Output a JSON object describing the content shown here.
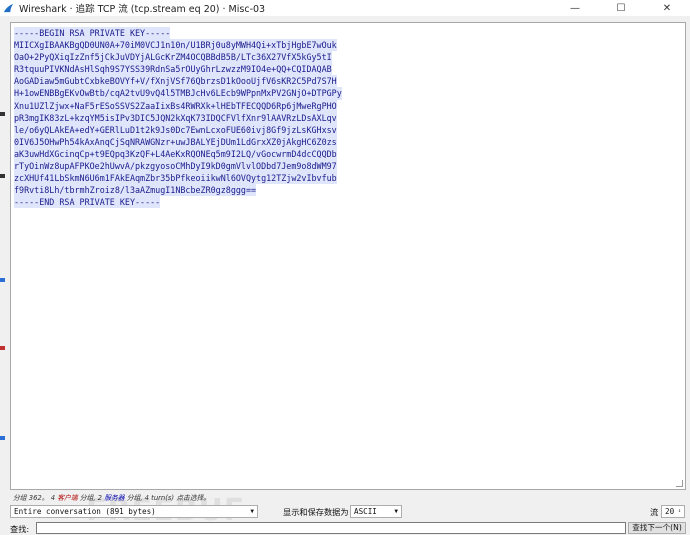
{
  "window": {
    "title": "Wireshark · 追踪 TCP 流 (tcp.stream eq 20) · Misc-03",
    "minimize": "—",
    "maximize": "☐",
    "close": "✕"
  },
  "stream": {
    "lines": [
      "-----BEGIN RSA PRIVATE KEY-----",
      "MIICXgIBAAKBgQD0UN0A+70iM0VCJ1n10n/U1BRj0u8yMWH4Qi+xTbjHgbE7wOuk",
      "OaO+2PyQXiqIzZnf5jCkJuVDYjALGcKrZM4OCQBBdB5B/LTc36X27VfX5kGy5tI",
      "R3tquuPIVKNdAsHlSqh9S7YSS39RdnSa5rOUyGhrLzwzzM9IO4e+QQ+CQIDAQAB",
      "AoGADiaw5mGubtCxbkeBOVYf+V/fXnjVSf76QbrzsD1kOooUjfV6sKR2C5Pd7S7H",
      "H+1owENBBgEKvOwBtb/cqA2tvU9vQ4l5TMBJcHv6LEcb9WPpnMxPV2GNjO+DTPGPy",
      "Xnu1UZlZjwx+NaF5rESoSSVS2ZaaIixBs4RWRXk+lHEbTFECQQD6Rp6jMweRgPHO",
      "pR3mgIK83zL+kzqYM5isIPv3DIC5JQN2kXqK73IDQCFVlfXnr9lAAVRzLDsAXLqv",
      "le/o6yQLAkEA+edY+GERlLuD1t2k9Js0Dc7EwnLcxoFUE60ivj8Gf9jzLsKGHxsv",
      "0IV6J5OHwPh54kAxAnqCjSqNRAWGNzr+uwJBALYEjDUm1LdGrxXZ0jAkgHC6Z0zs",
      "aK3uwHdXGcinqCp+t9EQpq3KzQF+L4AeKxRQONEq5m9I2LQ/vGocwrmD4dcCQQDb",
      "rTyOinWz8upAFPKOe2hUwvA/pkzgyosoCMhDyI9kD0gmVlvlODbd7Jem9o8dWM97",
      "zcXHUf41LbSkmN6U6m1FAkEAqmZbr35bPfkeoiikwNl6OVQytg12TZjw2vIbvfub",
      "f9Rvti8Lh/tbrmhZroiz8/l3aAZmugI1NBcbeZR0gz8ggg==",
      "-----END RSA PRIVATE KEY-----"
    ]
  },
  "summary": {
    "prefix": "分组 362。",
    "client_count": "4",
    "client_label": "客户端",
    "mid1": "分组, 2",
    "server_label": "服务器",
    "mid2": "分组, 4 turn(s) 点击选择。"
  },
  "controls": {
    "conversation_select": "Entire conversation (891 bytes)",
    "show_save_label": "显示和保存数据为",
    "format_select": "ASCII",
    "stream_label": "流",
    "stream_value": "20"
  },
  "find": {
    "label": "查找:",
    "value": "",
    "next_button": "查找下一个(N)"
  },
  "watermark": "FREEBUF",
  "colors": {
    "accent": "#1a1a8c",
    "highlight": "#dfe6fb"
  }
}
